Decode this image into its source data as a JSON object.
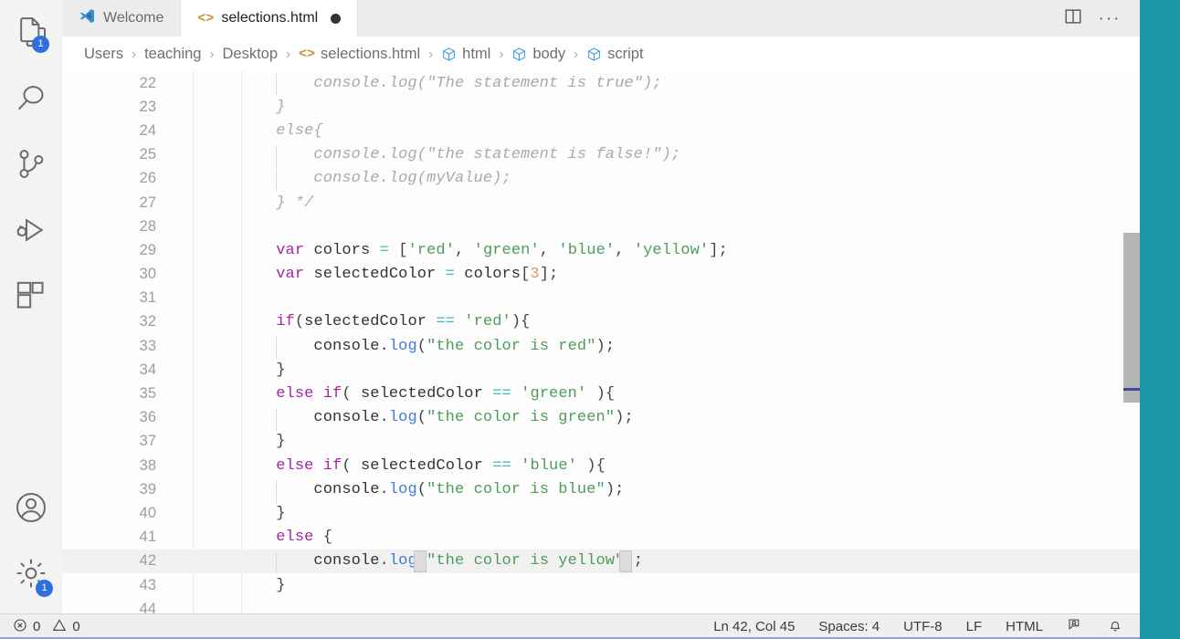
{
  "window": {
    "accent_teal": "#1d96a8",
    "tabbar_bg": "#ececec",
    "editor_bg": "#fdfdfd"
  },
  "activity_bar": {
    "items": [
      {
        "name": "explorer-icon",
        "label": "Explorer",
        "badge": "1"
      },
      {
        "name": "search-icon",
        "label": "Search",
        "badge": ""
      },
      {
        "name": "source-control-icon",
        "label": "Source Control",
        "badge": ""
      },
      {
        "name": "run-debug-icon",
        "label": "Run and Debug",
        "badge": ""
      },
      {
        "name": "extensions-icon",
        "label": "Extensions",
        "badge": ""
      }
    ],
    "bottom_items": [
      {
        "name": "account-icon",
        "label": "Accounts",
        "badge": ""
      },
      {
        "name": "settings-icon",
        "label": "Manage",
        "badge": "1"
      }
    ]
  },
  "tabs": [
    {
      "label": "Welcome",
      "icon": "vscode-logo-icon",
      "active": false,
      "dirty": false
    },
    {
      "label": "selections.html",
      "icon": "html-tag-icon",
      "active": true,
      "dirty": true
    }
  ],
  "tab_actions": {
    "split_editor": "split-editor-icon",
    "more_actions": "···"
  },
  "breadcrumbs": [
    {
      "label": "Users",
      "icon": ""
    },
    {
      "label": "teaching",
      "icon": ""
    },
    {
      "label": "Desktop",
      "icon": ""
    },
    {
      "label": "selections.html",
      "icon": "html-tag-icon"
    },
    {
      "label": "html",
      "icon": "symbol-cube-icon"
    },
    {
      "label": "body",
      "icon": "symbol-cube-icon"
    },
    {
      "label": "script",
      "icon": "symbol-cube-icon"
    }
  ],
  "breadcrumb_separator": "›",
  "editor": {
    "first_line": 22,
    "current_line": 42,
    "lines": [
      {
        "n": 22,
        "text": "        console.log(\"The statement is true\");"
      },
      {
        "n": 23,
        "text": "    }"
      },
      {
        "n": 24,
        "text": "    else{"
      },
      {
        "n": 25,
        "text": "        console.log(\"the statement is false!\");"
      },
      {
        "n": 26,
        "text": "        console.log(myValue);"
      },
      {
        "n": 27,
        "text": "    } */"
      },
      {
        "n": 28,
        "text": ""
      },
      {
        "n": 29,
        "text": "    var colors = ['red', 'green', 'blue', 'yellow'];"
      },
      {
        "n": 30,
        "text": "    var selectedColor = colors[3];"
      },
      {
        "n": 31,
        "text": ""
      },
      {
        "n": 32,
        "text": "    if(selectedColor == 'red'){"
      },
      {
        "n": 33,
        "text": "        console.log(\"the color is red\");"
      },
      {
        "n": 34,
        "text": "    }"
      },
      {
        "n": 35,
        "text": "    else if( selectedColor == 'green' ){"
      },
      {
        "n": 36,
        "text": "        console.log(\"the color is green\");"
      },
      {
        "n": 37,
        "text": "    }"
      },
      {
        "n": 38,
        "text": "    else if( selectedColor == 'blue' ){"
      },
      {
        "n": 39,
        "text": "        console.log(\"the color is blue\");"
      },
      {
        "n": 40,
        "text": "    }"
      },
      {
        "n": 41,
        "text": "    else {"
      },
      {
        "n": 42,
        "text": "        console.log(\"the color is yellow\");"
      },
      {
        "n": 43,
        "text": "    }"
      },
      {
        "n": 44,
        "text": ""
      }
    ]
  },
  "status_bar": {
    "errors": "0",
    "warnings": "0",
    "position": "Ln 42, Col 45",
    "indentation": "Spaces: 4",
    "encoding": "UTF-8",
    "eol": "LF",
    "language": "HTML",
    "feedback_icon": "feedback-smiley-icon",
    "notifications_icon": "bell-icon"
  }
}
